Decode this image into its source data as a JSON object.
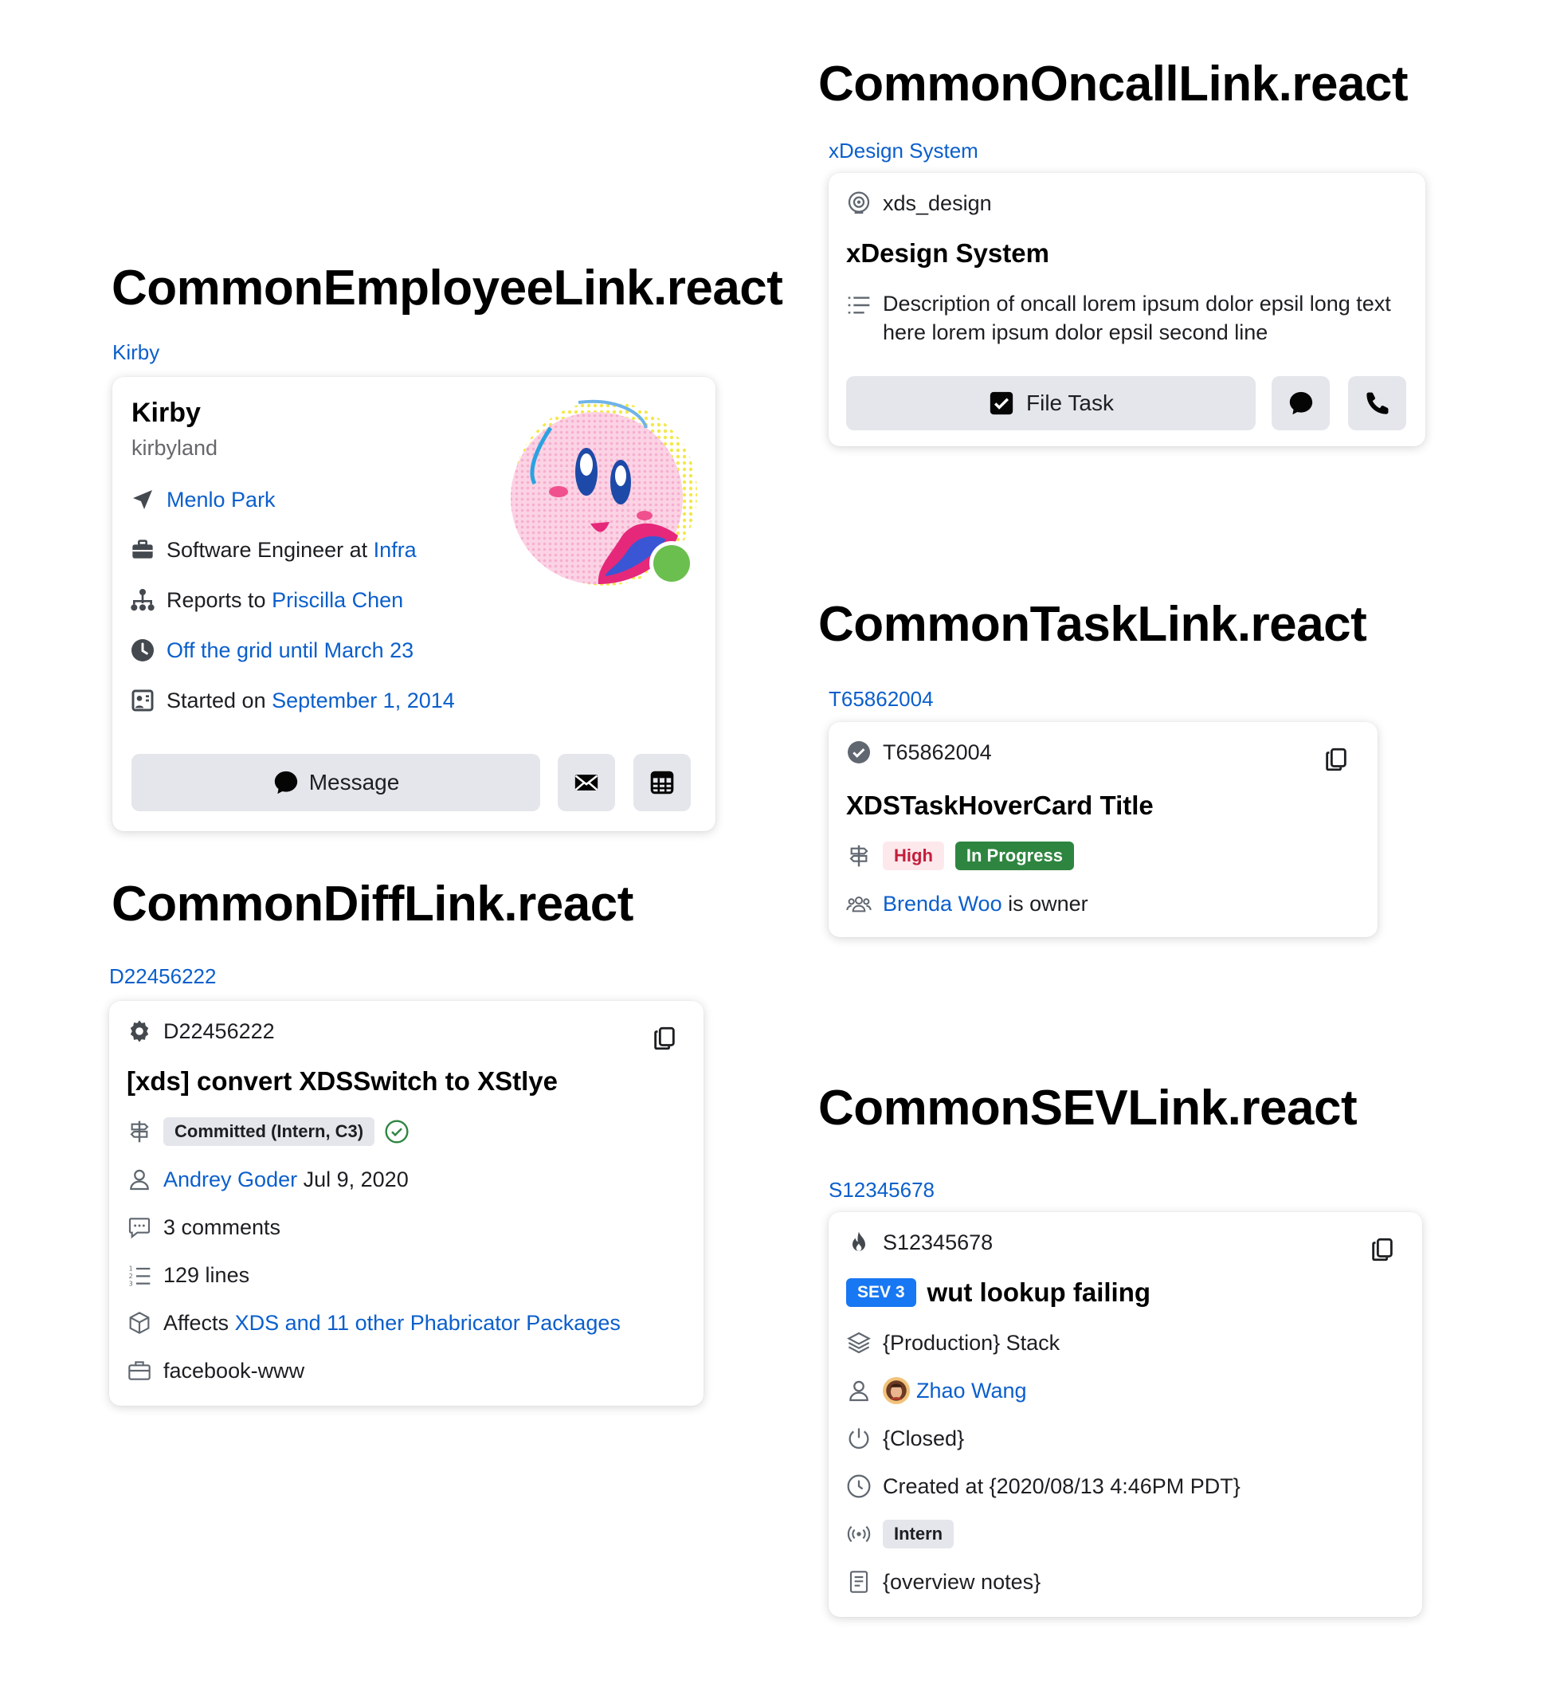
{
  "employee": {
    "heading": "CommonEmployeeLink.react",
    "link": "Kirby",
    "name": "Kirby",
    "username": "kirbyland",
    "location": "Menlo Park",
    "job_prefix": "Software Engineer at",
    "job_team": "Infra",
    "reports_prefix": "Reports to",
    "manager": "Priscilla Chen",
    "status": "Off the grid until March 23",
    "started_prefix": "Started on",
    "start_date": "September 1, 2014",
    "message_label": "Message",
    "presence_color": "#6bbf4e"
  },
  "diff": {
    "heading": "CommonDiffLink.react",
    "link": "D22456222",
    "id": "D22456222",
    "title": "[xds] convert XDSSwitch to XStlye",
    "status_tag": "Committed (Intern, C3)",
    "author": "Andrey Goder",
    "date": "Jul 9, 2020",
    "comments": "3 comments",
    "lines": "129 lines",
    "affects_prefix": "Affects",
    "affects_link": "XDS and 11 other Phabricator Packages",
    "repo": "facebook-www"
  },
  "oncall": {
    "heading": "CommonOncallLink.react",
    "link": "xDesign System",
    "handle": "xds_design",
    "title": "xDesign System",
    "description_line1": "Description of oncall lorem ipsum dolor epsil long text",
    "description_line2": "here lorem ipsum dolor epsil second line",
    "file_task_label": "File Task"
  },
  "task": {
    "heading": "CommonTaskLink.react",
    "link": "T65862004",
    "id": "T65862004",
    "title": "XDSTaskHoverCard Title",
    "priority": "High",
    "status": "In Progress",
    "owner": "Brenda Woo",
    "owner_suffix": "is owner",
    "priority_bg": "#fde8ec",
    "priority_color": "#c41e3a",
    "status_bg": "#2e8540"
  },
  "sev": {
    "heading": "CommonSEVLink.react",
    "link": "S12345678",
    "id": "S12345678",
    "badge": "SEV 3",
    "title": "wut lookup failing",
    "stack": "{Production} Stack",
    "owner": "Zhao Wang",
    "state": "{Closed}",
    "created": "Created at {2020/08/13 4:46PM PDT}",
    "tag": "Intern",
    "notes": "{overview notes}",
    "badge_color": "#1877f2"
  },
  "colors": {
    "link": "#0b5fcc",
    "button_bg": "#e4e6eb",
    "secondary_text": "#65676b"
  }
}
